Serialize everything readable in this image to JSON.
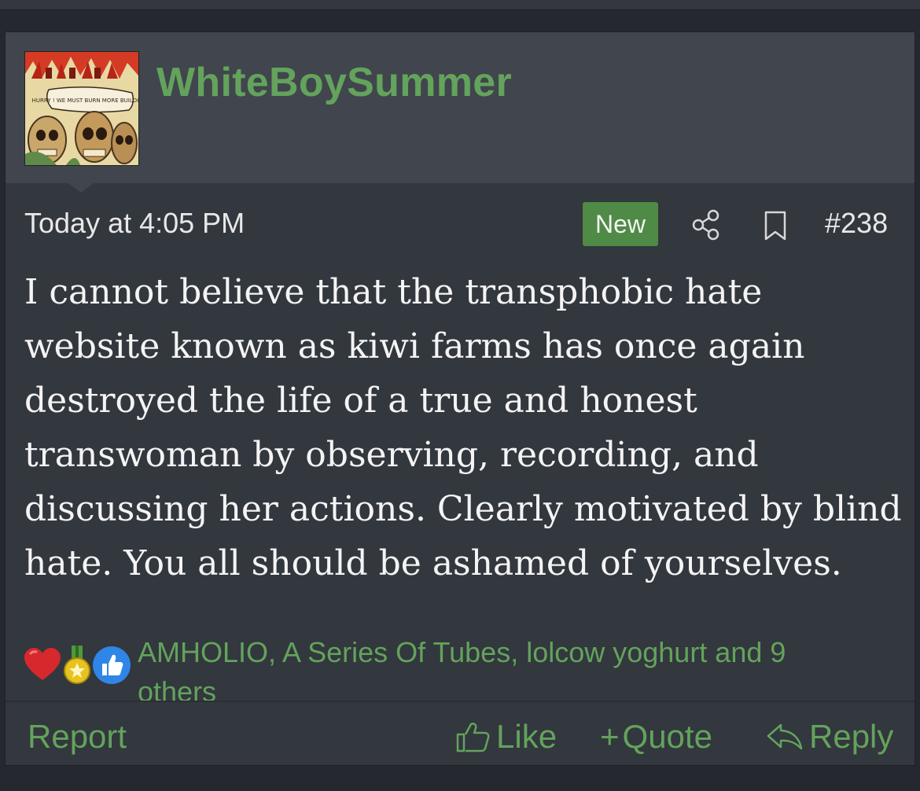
{
  "post": {
    "username": "WhiteBoySummer",
    "avatar_caption": "HURRY ! WE MUST BURN MORE BUILDINGS",
    "timestamp": "Today at 4:05 PM",
    "new_badge": "New",
    "post_number": "#238",
    "message": "I cannot believe that the transphobic hate website known as kiwi farms has once again destroyed the life of a true and honest transwoman by observing, recording, and discussing her actions. Clearly motivated by blind hate. You all should be ashamed of yourselves.",
    "reactions_text": "AMHOLIO, A Series Of Tubes, lolcow yoghurt and 9 others",
    "reaction_icons": [
      "heart-icon",
      "medal-icon",
      "thumbs-up-icon"
    ]
  },
  "actions": {
    "report": "Report",
    "like": "Like",
    "quote": "Quote",
    "reply": "Reply"
  },
  "colors": {
    "accent": "#63a35c",
    "badge": "#4f8a46",
    "card": "#33373e",
    "header": "#41454d",
    "page": "#25282e"
  }
}
